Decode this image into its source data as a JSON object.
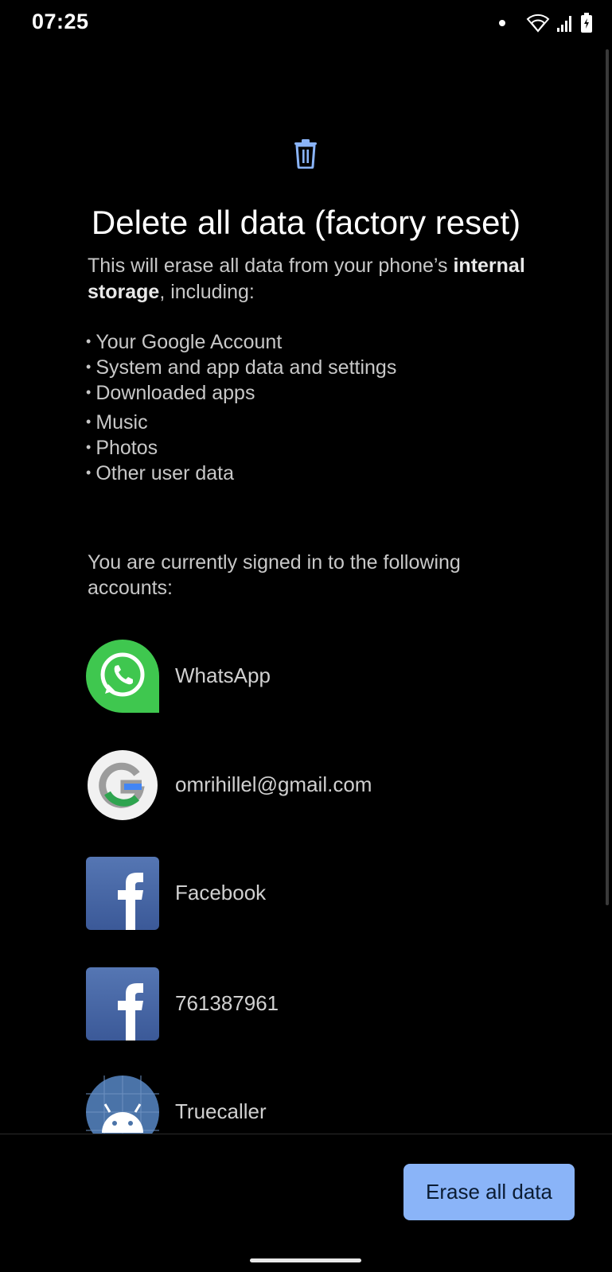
{
  "status_bar": {
    "time": "07:25"
  },
  "page": {
    "title": "Delete all data (factory reset)",
    "desc_prefix": "This will erase all data from your phone’s ",
    "desc_bold": "internal storage",
    "desc_suffix": ", including:",
    "bullets": [
      "Your Google Account",
      "System and app data and settings",
      "Downloaded apps",
      "Music",
      "Photos",
      "Other user data"
    ],
    "accounts_label": "You are currently signed in to the following accounts:",
    "accounts": [
      {
        "name": "WhatsApp",
        "icon": "whatsapp-icon"
      },
      {
        "name": "omrihillel@gmail.com",
        "icon": "google-icon"
      },
      {
        "name": "Facebook",
        "icon": "facebook-icon"
      },
      {
        "name": "761387961",
        "icon": "facebook-icon"
      },
      {
        "name": "Truecaller",
        "icon": "android-icon"
      }
    ],
    "erase_button": "Erase all data"
  },
  "colors": {
    "accent": "#8ab4f8",
    "background": "#000000"
  }
}
